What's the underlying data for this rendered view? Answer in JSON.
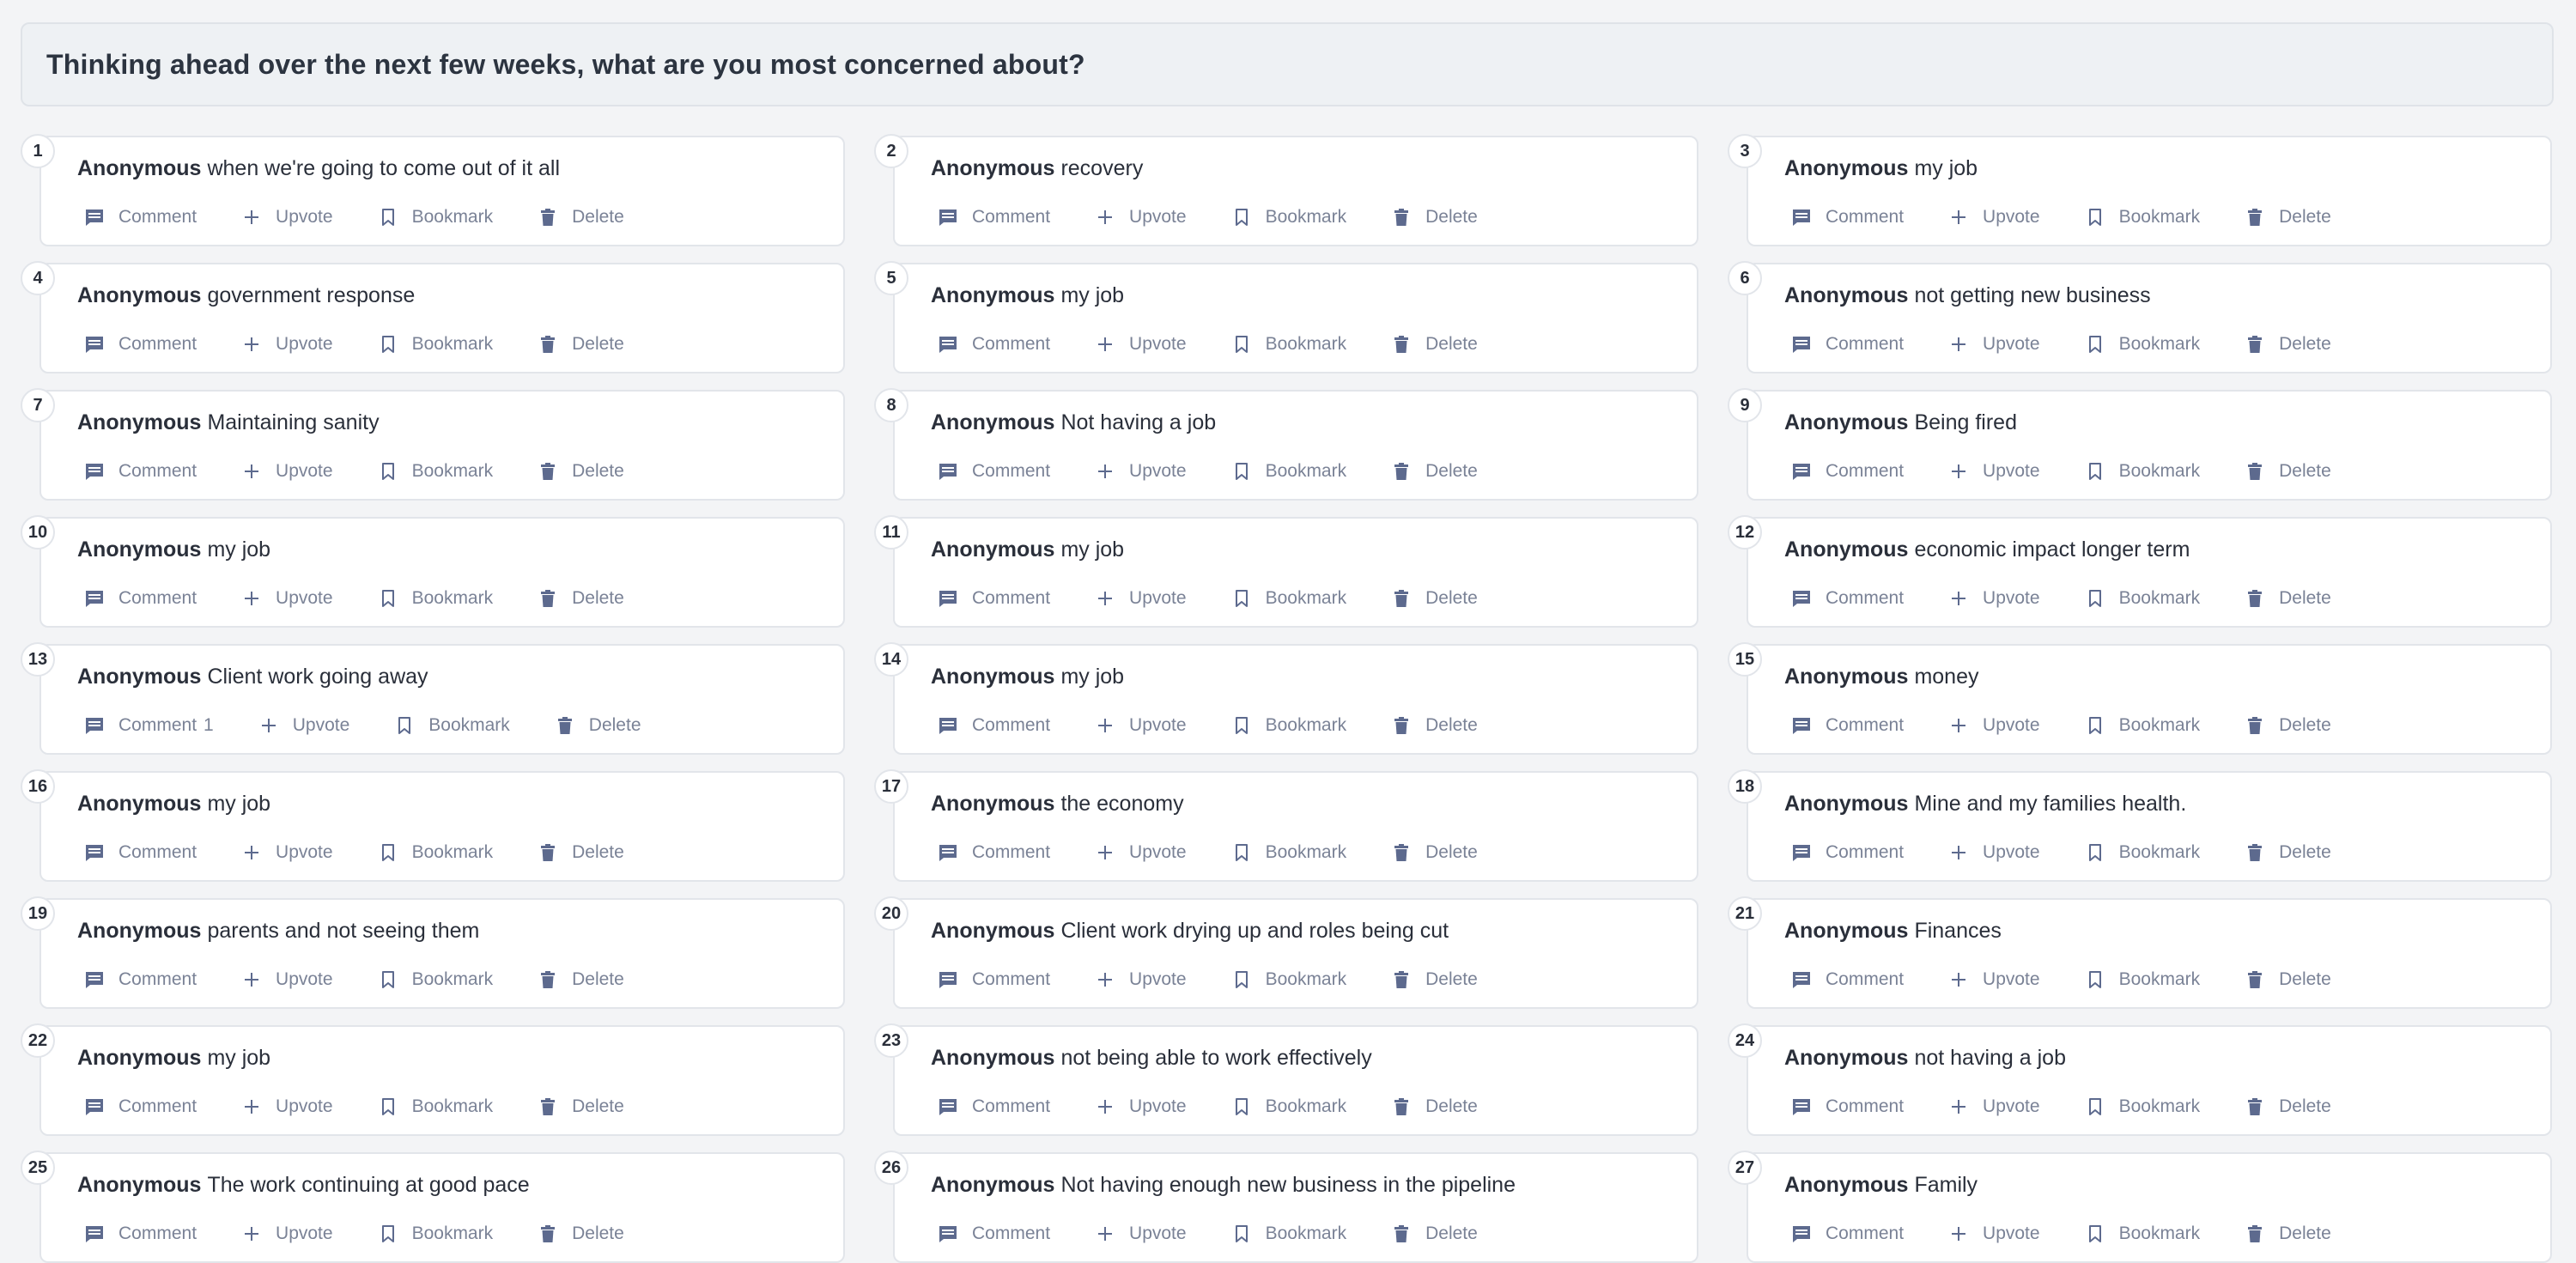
{
  "header": {
    "title": "Thinking ahead over the next few weeks, what are you most concerned about?"
  },
  "actions": {
    "comment": "Comment",
    "upvote": "Upvote",
    "bookmark": "Bookmark",
    "delete": "Delete"
  },
  "colors": {
    "icon": "#5d6a8e",
    "action_text": "#7a8296",
    "card_border": "#e2e5ea",
    "header_bg": "#eef1f4"
  },
  "icons": {
    "comment": "comment-icon",
    "upvote": "plus-icon",
    "bookmark": "bookmark-icon",
    "delete": "trash-icon"
  },
  "responses": [
    {
      "number": "1",
      "author": "Anonymous",
      "text": "when we're going to come out of it all",
      "comment_count": ""
    },
    {
      "number": "2",
      "author": "Anonymous",
      "text": "recovery",
      "comment_count": ""
    },
    {
      "number": "3",
      "author": "Anonymous",
      "text": "my job",
      "comment_count": ""
    },
    {
      "number": "4",
      "author": "Anonymous",
      "text": "government response",
      "comment_count": ""
    },
    {
      "number": "5",
      "author": "Anonymous",
      "text": "my job",
      "comment_count": ""
    },
    {
      "number": "6",
      "author": "Anonymous",
      "text": "not getting new business",
      "comment_count": ""
    },
    {
      "number": "7",
      "author": "Anonymous",
      "text": "Maintaining sanity",
      "comment_count": ""
    },
    {
      "number": "8",
      "author": "Anonymous",
      "text": "Not having a job",
      "comment_count": ""
    },
    {
      "number": "9",
      "author": "Anonymous",
      "text": "Being fired",
      "comment_count": ""
    },
    {
      "number": "10",
      "author": "Anonymous",
      "text": "my job",
      "comment_count": ""
    },
    {
      "number": "11",
      "author": "Anonymous",
      "text": "my job",
      "comment_count": ""
    },
    {
      "number": "12",
      "author": "Anonymous",
      "text": "economic impact longer term",
      "comment_count": ""
    },
    {
      "number": "13",
      "author": "Anonymous",
      "text": "Client work going away",
      "comment_count": "1"
    },
    {
      "number": "14",
      "author": "Anonymous",
      "text": "my job",
      "comment_count": ""
    },
    {
      "number": "15",
      "author": "Anonymous",
      "text": "money",
      "comment_count": ""
    },
    {
      "number": "16",
      "author": "Anonymous",
      "text": "my job",
      "comment_count": ""
    },
    {
      "number": "17",
      "author": "Anonymous",
      "text": "the economy",
      "comment_count": ""
    },
    {
      "number": "18",
      "author": "Anonymous",
      "text": "Mine and my families health.",
      "comment_count": ""
    },
    {
      "number": "19",
      "author": "Anonymous",
      "text": "parents and not seeing them",
      "comment_count": ""
    },
    {
      "number": "20",
      "author": "Anonymous",
      "text": "Client work drying up and roles being cut",
      "comment_count": ""
    },
    {
      "number": "21",
      "author": "Anonymous",
      "text": "Finances",
      "comment_count": ""
    },
    {
      "number": "22",
      "author": "Anonymous",
      "text": "my job",
      "comment_count": ""
    },
    {
      "number": "23",
      "author": "Anonymous",
      "text": "not being able to work effectively",
      "comment_count": ""
    },
    {
      "number": "24",
      "author": "Anonymous",
      "text": "not having a job",
      "comment_count": ""
    },
    {
      "number": "25",
      "author": "Anonymous",
      "text": "The work continuing at good pace",
      "comment_count": ""
    },
    {
      "number": "26",
      "author": "Anonymous",
      "text": "Not having enough new business in the pipeline",
      "comment_count": ""
    },
    {
      "number": "27",
      "author": "Anonymous",
      "text": "Family",
      "comment_count": ""
    }
  ]
}
